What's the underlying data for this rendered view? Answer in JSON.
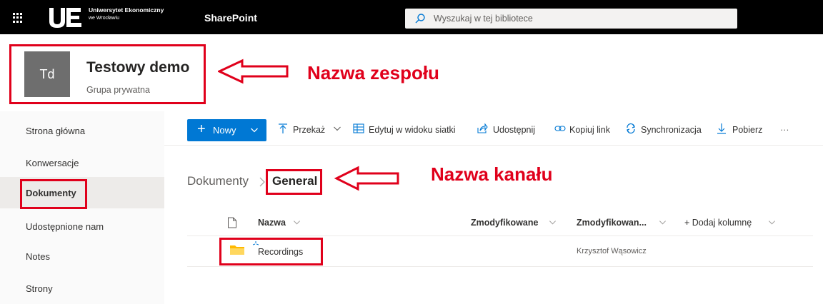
{
  "topbar": {
    "org_line1": "Uniwersytet Ekonomiczny",
    "org_line2": "we Wrocławiu",
    "app_name": "SharePoint",
    "search_placeholder": "Wyszukaj w tej bibliotece"
  },
  "site": {
    "avatar_initials": "Td",
    "name": "Testowy demo",
    "type": "Grupa prywatna"
  },
  "annotations": {
    "team_label": "Nazwa zespołu",
    "channel_label": "Nazwa kanału",
    "color": "#e0001b"
  },
  "nav": {
    "items": [
      {
        "label": "Strona główna"
      },
      {
        "label": "Konwersacje"
      },
      {
        "label": "Dokumenty",
        "selected": true
      },
      {
        "label": "Udostępnione nam"
      },
      {
        "label": "Notes"
      },
      {
        "label": "Strony"
      }
    ]
  },
  "commands": {
    "new": "Nowy",
    "upload": "Przekaż",
    "grid_edit": "Edytuj w widoku siatki",
    "share": "Udostępnij",
    "copy_link": "Kopiuj link",
    "sync": "Synchronizacja",
    "download": "Pobierz",
    "more": "···"
  },
  "breadcrumb": {
    "root": "Dokumenty",
    "current": "General"
  },
  "table": {
    "columns": {
      "name": "Nazwa",
      "modified": "Zmodyfikowane",
      "modified_by": "Zmodyfikowan...",
      "add_column": "+ Dodaj kolumnę"
    },
    "rows": [
      {
        "name": "Recordings",
        "modified": "",
        "modified_by": "Krzysztof Wąsowicz",
        "icon": "folder-icon"
      }
    ]
  },
  "colors": {
    "accent": "#0078d4",
    "topbar": "#000000",
    "folder": "#ffb900"
  }
}
